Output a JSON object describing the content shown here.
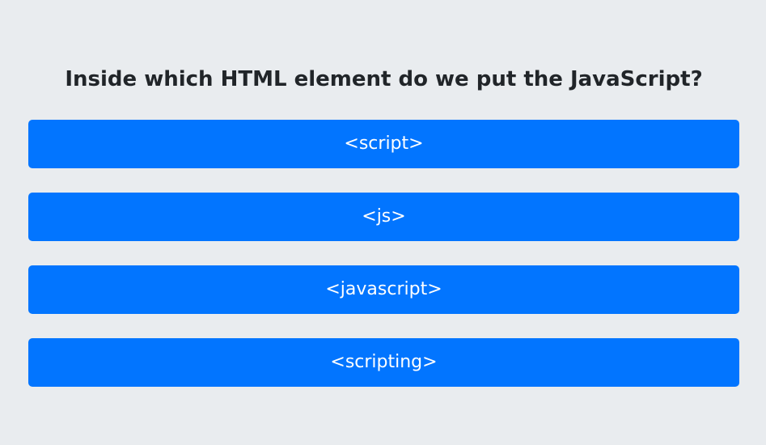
{
  "quiz": {
    "question": "Inside which HTML element do we put the JavaScript?",
    "answers": [
      {
        "label": "<script>"
      },
      {
        "label": "<js>"
      },
      {
        "label": "<javascript>"
      },
      {
        "label": "<scripting>"
      }
    ]
  },
  "colors": {
    "background": "#e9ecef",
    "button": "#0275ff",
    "button_text": "#ffffff",
    "question_text": "#212529"
  }
}
